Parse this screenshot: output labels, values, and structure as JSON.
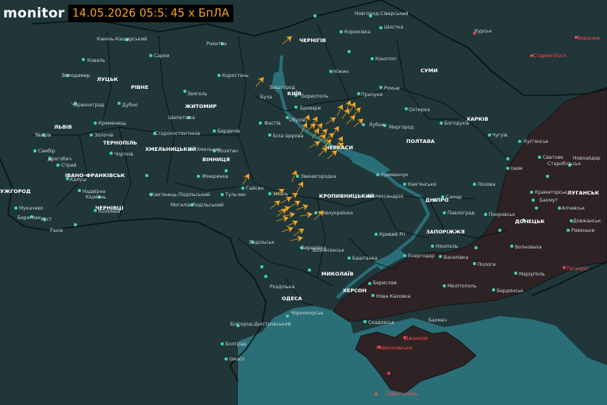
{
  "header": {
    "brand": "monitor",
    "datetime": "14.05.2026 05:53",
    "count": "45 х БпЛА"
  },
  "colors": {
    "land": "#203638",
    "sea": "#2a6f78",
    "occupied": "#2e2224",
    "border": "#0b1314",
    "drone": "#f5a623",
    "city_dot": "#3fd1b4",
    "russia_city": "#ff4d4d"
  },
  "icons": {
    "drone": "drone-icon",
    "city": "city-dot-icon"
  },
  "drone_count": 45,
  "regions": [
    "ЛУЦЬК",
    "РІВНЕ",
    "ЖИТОМИР",
    "ЧЕРНІГІВ",
    "СУМИ",
    "КИЇВ",
    "ХАРКІВ",
    "ЛЬВІВ",
    "ТЕРНОПІЛЬ",
    "ХМЕЛЬНИЦЬКИЙ",
    "ВІННИЦЯ",
    "ЧЕРКАСИ",
    "ПОЛТАВА",
    "ІВАНО-ФРАНКІВСЬК",
    "УЖГОРОД",
    "ЧЕРНІВЦІ",
    "КРОПИВНИЦЬКИЙ",
    "ДНІПРО",
    "ЗАПОРІЖЖЯ",
    "ДОНЕЦЬК",
    "ЛУГАНСЬК",
    "МИКОЛАЇВ",
    "ОДЕСА",
    "ХЕРСОН"
  ],
  "cities": [
    "Камінь-Каширський",
    "Ковель",
    "Сарни",
    "Володимир",
    "Рокитне",
    "Червоноград",
    "Дубно",
    "Звягель",
    "Коростень",
    "Бровари",
    "Борисполь",
    "Фастів",
    "Біла Церква",
    "Обухів",
    "Прилуки",
    "Лубни",
    "Миргород",
    "Новгород-Сіверський",
    "Шостка",
    "Корюківка",
    "Ніжин",
    "Конотоп",
    "Глухів",
    "Ромни",
    "Охтирка",
    "Богодухів",
    "Чугуїв",
    "Куп'янськ",
    "Лозова",
    "Ізюм",
    "Сватове",
    "Старобільськ",
    "Новоайдар",
    "Краматорськ",
    "Бахмут",
    "Алчевськ",
    "Довжанськ",
    "Ровеньки",
    "Покровськ",
    "Волноваха",
    "Маріуполь",
    "Бердянськ",
    "Мелітополь",
    "Пологи",
    "Василівка",
    "Енергодар",
    "Нікополь",
    "Кривий Ріг",
    "Кам'янське",
    "Павлоград",
    "Самар",
    "Синельникове",
    "Кременчук",
    "Олександрія",
    "Новоукраїнка",
    "Голованівськ",
    "Умань",
    "Звенигородка",
    "Гайсин",
    "Тульчин",
    "Жмеринка",
    "Могилів-Подільський",
    "Кам'янець-Подільський",
    "Шепетівка",
    "Хмельник",
    "Старокостянтинів",
    "Бердичів",
    "Козятин",
    "Подільськ",
    "Балта",
    "Роздільна",
    "Березівка",
    "Вознесенськ",
    "Первомайськ",
    "Баштанка",
    "Берислав",
    "Нова Каховка",
    "Скадовськ",
    "Джанкой",
    "Новоселівське",
    "Сімферополь",
    "Севастополь",
    "Білгород-Дністровський",
    "Болград",
    "Ізмаїл",
    "Чорноморськ",
    "Мукачево",
    "Берегове",
    "Хуст",
    "Рахів",
    "Коломия",
    "Калуш",
    "Стрий",
    "Дрогобич",
    "Самбір",
    "Яворів",
    "Золочів",
    "Чортків",
    "Кременець",
    "Вінниця",
    "Бар",
    "Надвірна",
    "Кіцмань",
    "Дністровськ",
    "Вишгород",
    "Буча",
    "Чернігів",
    "Гадяч",
    "Курськ",
    "Воронеж",
    "Старий Оскіл",
    "Таганрог",
    "Енергодар",
    "Вільнянськ",
    "Токмак",
    "Запоріжжя",
    "Бахмач",
    "Генічеськ",
    "Донецьк"
  ]
}
